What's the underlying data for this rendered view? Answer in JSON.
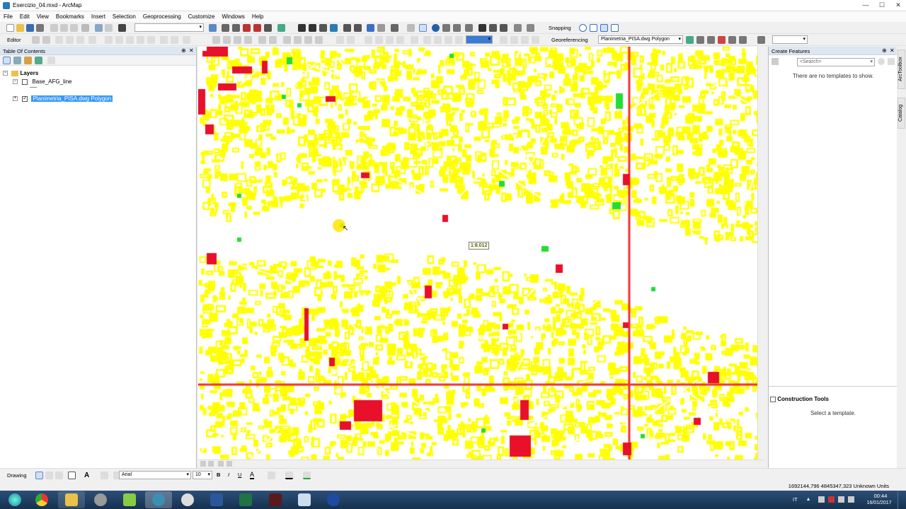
{
  "window": {
    "title": "Esercizio_04.mxd - ArcMap",
    "minimize": "—",
    "maximize": "☐",
    "close": "✕"
  },
  "menu": [
    "File",
    "Edit",
    "View",
    "Bookmarks",
    "Insert",
    "Selection",
    "Geoprocessing",
    "Customize",
    "Windows",
    "Help"
  ],
  "toolbar": {
    "snapping_label": "Snapping",
    "editor_label": "Editor",
    "georeferencing_label": "Georeferencing",
    "georef_layer": "Planimetria_PISA.dwg Polygon"
  },
  "toc": {
    "title": "Table Of Contents",
    "root_label": "Layers",
    "layers": [
      {
        "name": "Base_AFG_line",
        "checked": false,
        "selected": false
      },
      {
        "name": "Planimetria_PISA.dwg Polygon",
        "checked": true,
        "selected": true
      }
    ]
  },
  "map": {
    "scale_tooltip": "1:8.012",
    "colors": {
      "background": "#ffffff",
      "buildings": "#ffff00",
      "red_features": "#e8102a",
      "green_features": "#22dd33",
      "road_lines": "#f03030"
    }
  },
  "create_features": {
    "title": "Create Features",
    "search_placeholder": "<Search>",
    "no_templates": "There are no templates to show.",
    "construction_title": "Construction Tools",
    "construction_hint": "Select a template."
  },
  "side_tabs": [
    "ArcToolbox",
    "Catalog"
  ],
  "drawing": {
    "label": "Drawing",
    "font": "Arial",
    "font_size": "10",
    "bold": "B",
    "italic": "I",
    "underline": "U"
  },
  "status": {
    "coordinates": "1692144,796  4845347,323 Unknown Units"
  },
  "taskbar": {
    "language": "IT",
    "time": "00:44",
    "date": "16/01/2017",
    "apps": [
      "start-icon",
      "chrome-icon",
      "explorer-icon",
      "media-icon",
      "qgis-icon",
      "arcmap-icon",
      "itunes-icon",
      "word-icon",
      "excel-icon",
      "app-icon",
      "notepad-icon",
      "bluetooth-icon"
    ]
  }
}
